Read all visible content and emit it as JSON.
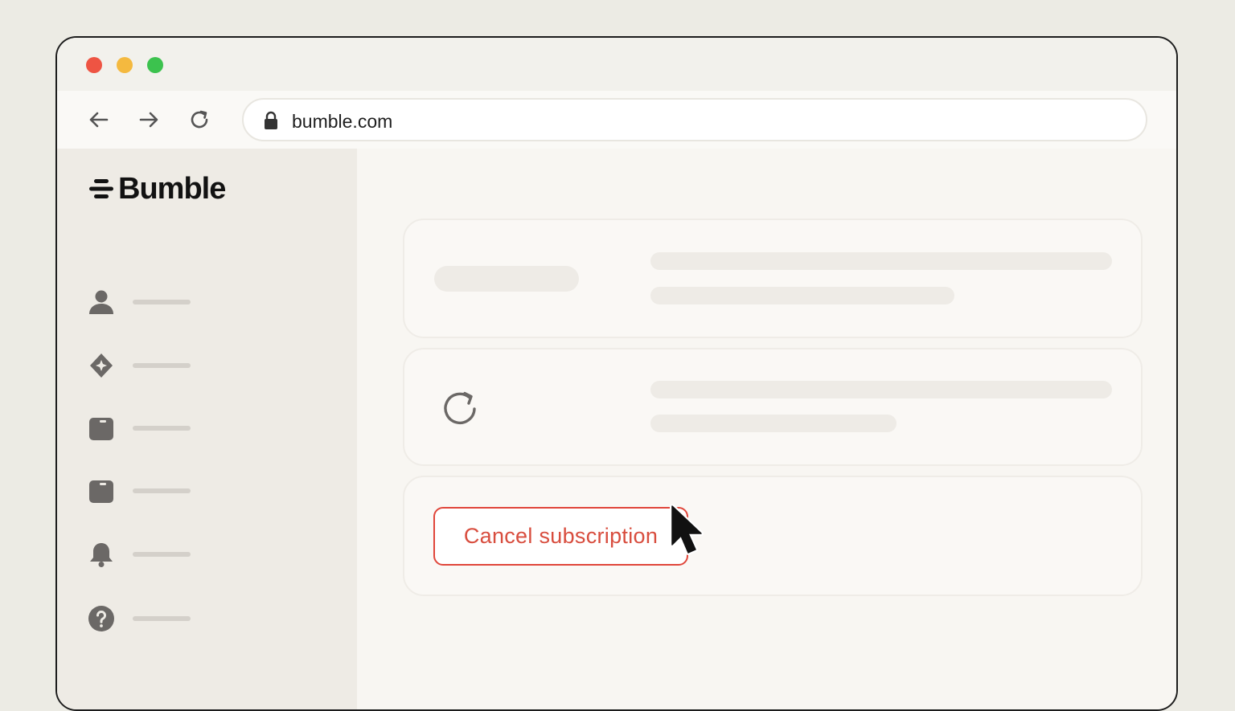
{
  "browser": {
    "url": "bumble.com",
    "traffic_lights": {
      "close": "#ee5443",
      "minimize": "#f4b93f",
      "maximize": "#3cc24e"
    }
  },
  "sidebar": {
    "logo_text": "Bumble",
    "items": [
      {
        "icon": "user-icon"
      },
      {
        "icon": "sparkle-icon"
      },
      {
        "icon": "folder-icon"
      },
      {
        "icon": "folder-icon"
      },
      {
        "icon": "bell-icon"
      },
      {
        "icon": "help-icon"
      }
    ]
  },
  "main": {
    "cancel_button_label": "Cancel subscription",
    "accent_color": "#e0463a"
  }
}
